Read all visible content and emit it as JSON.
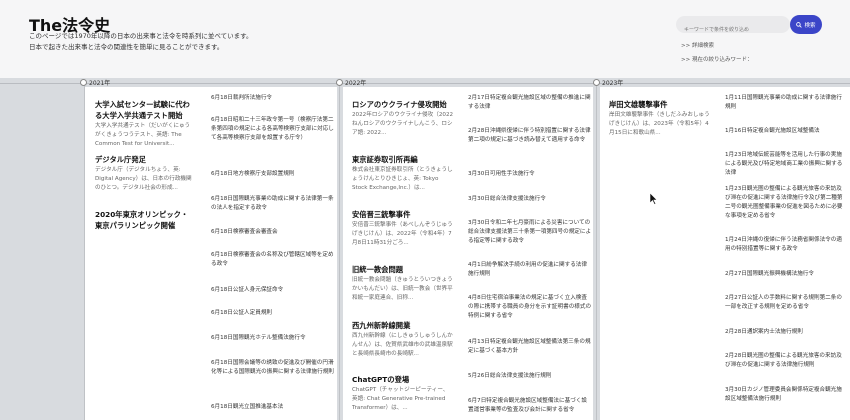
{
  "header": {
    "title": "The法令史",
    "description_line1": "このページでは1970年以降の日本の出来事と法令を時系列に並べています。",
    "description_line2": "日本で起きた出来事と法令の関連性を簡単に見ることができます。",
    "search_placeholder": "キーワードで条件を絞り込め",
    "search_button": "検索",
    "link_advanced": ">> 詳細検索",
    "link_current": ">> 現在の絞り込みワード："
  },
  "years": [
    {
      "label": "2021年",
      "events": [
        {
          "title": "大学入試センター試験に代わる大学入学共通テスト開始",
          "desc": "大学入学共通テスト（だいがくにゅうがくきょうつうテスト、英語: The Common Test for Universit..."
        },
        {
          "title": "デジタル庁発足",
          "desc": "デジタル庁（デジタルちょう、英: Digital Agency）は、日本の行政機関のひとつ。デジタル社会の形成..."
        },
        {
          "title": "2020年東京オリンピック・東京パラリンピック開催",
          "desc": ""
        }
      ],
      "laws": [
        "6月18日裁判所法施行令",
        "6月18日昭和二十三年政令第一号（検察庁法第二条第四項の規定による各高等検察庁支部に対応して各高等検察庁支部を設置する庁令）",
        "6月18日地方検察庁支部設置規則",
        "6月18日国際観光事業の助成に関する法律第一条の法人を指定する政令",
        "6月18日検察審査会審査会",
        "6月18日検察審査会の名称及び管轄区域等を定める政令",
        "6月18日公証人身元保証命令",
        "6月18日公証人定員規則",
        "6月18日国際観光ホテル整備法施行令",
        "6月18日国際会議等の誘致の促進及び開催の円滑化等による国際観光の振興に関する法律施行規則",
        "6月18日観光立国推進基本法"
      ]
    },
    {
      "label": "2022年",
      "events": [
        {
          "title": "ロシアのウクライナ侵攻開始",
          "desc": "2022年ロシアのウクライナ侵攻（2022ねんロシアのウクライナしんこう、ロシア語: 2022..."
        },
        {
          "title": "東京証券取引所再編",
          "desc": "株式会社東京証券取引所（とうきょうしょうけんとりひきじょ、英: Tokyo Stock Exchange,Inc.）は..."
        },
        {
          "title": "安倍晋三銃撃事件",
          "desc": "安倍晋三銃撃事件（あべしんぞうじゅうげきじけん）は、2022年（令和4年）7月8日11時31分ごろ..."
        },
        {
          "title": "旧統一教会問題",
          "desc": "旧統一教会問題（きゅうとういつきょうかいもんだい）は、旧統一教会（世界平和統一家庭連合、旧称..."
        },
        {
          "title": "西九州新幹線開業",
          "desc": "西九州新幹線（にしきゅうしゅうしんかんせん）は、佐賀県武雄市の武雄温泉駅と長崎県長崎市の長崎駅..."
        },
        {
          "title": "ChatGPTの登場",
          "desc": "ChatGPT（チャットジーピーティー、英語: Chat Generative Pre-trained Transformer）は、..."
        }
      ],
      "laws": [
        "2月17日特定複合観光施設区域の整備の推進に関する法律",
        "2月28日沖縄県復帰に伴う特別措置に関する法律第二項の規定に基づき読み替えて適用する命令",
        "3月30日可用性手法施行令",
        "3月30日総合法律支援法施行令",
        "3月30日令和二年七月豪雨による災害についての総合法律支援法第三十条第一項第四号の規定による指定等に関する政令",
        "4月1日紛争解決手続の利用の促進に関する法律施行規則",
        "4月8日住宅宿泊事業法の規定に基づく立入検査の際に携帯する職員の身分を示す証明書の様式の特例に関する省令",
        "4月13日特定複合観光施設区域整備法第三条の規定に基づく基本方針",
        "5月26日総合法律支援法施行規則",
        "6月7日特定複合観光施設区域整備法に基づく設置運営事業等の監査及び会計に関する省令"
      ]
    },
    {
      "label": "2023年",
      "events": [
        {
          "title": "岸田文雄襲撃事件",
          "desc": "岸田文雄襲撃事件（きしだふみおしゅうげきじけん）は、2023年（令和5年）4月15日に和歌山県..."
        }
      ],
      "laws": [
        "1月11日国際観光事業の助成に関する法律施行規則",
        "1月16日特定複合観光施設区域整備法",
        "1月23日地域伝統芸能等を活用した行事の実施による観光及び特定地域商工業の振興に関する法律",
        "1月23日観光圏の整備による観光旅客の来訪及び滞在の促進に関する法律施行令及び第二種第二号の観光圏整備事業の促進を図るために必要な事項を定める省令",
        "1月24日沖縄の復帰に伴う法務省関係法令の適用の特別措置等に関する政令",
        "2月27日国際観光振興機構法施行令",
        "2月27日公証人の手数料に関する規則第二条の一部を改正する規則を定める省令",
        "2月28日通訳案内士法施行規則",
        "2月28日観光圏の整備による観光旅客の来訪及び滞在の促進に関する法律施行規則",
        "3月30日カジノ管理委員会関係特定複合観光施設区域整備法施行規則"
      ]
    }
  ]
}
